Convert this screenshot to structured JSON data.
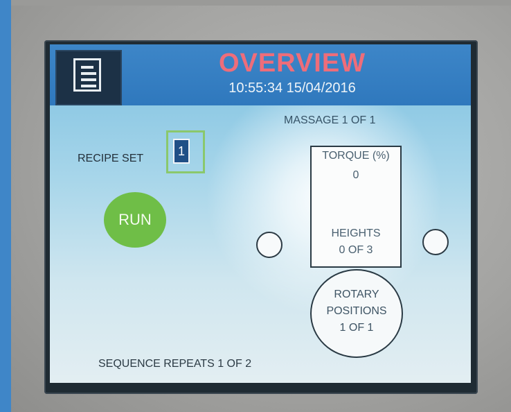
{
  "header": {
    "title": "OVERVIEW",
    "datetime": "10:55:34 15/04/2016",
    "menu_icon": "menu-list-icon"
  },
  "massage": "MASSAGE 1 OF 1",
  "recipe": {
    "label": "RECIPE SET",
    "value": "1"
  },
  "run_label": "RUN",
  "torque": {
    "label": "TORQUE (%)",
    "value": "0",
    "heights_label": "HEIGHTS",
    "heights_value": "0 OF 3"
  },
  "rotary": {
    "line1": "ROTARY",
    "line2": "POSITIONS",
    "line3": "1 OF 1"
  },
  "sequence": "SEQUENCE REPEATS 1 OF 2",
  "colors": {
    "header": "#3d86c8",
    "title": "#ee6d7a",
    "run": "#6fbe47",
    "recipe_border": "#8ac86c"
  }
}
